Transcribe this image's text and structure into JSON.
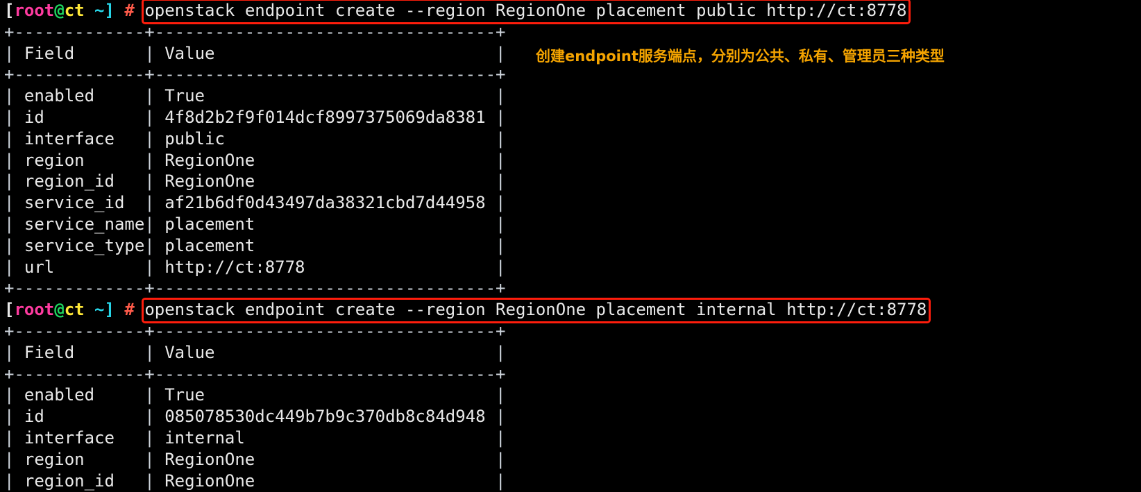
{
  "terminal": {
    "prompt": {
      "open_bracket": "[",
      "user": "root",
      "at": "@",
      "host": "ct",
      "path_close": " ~]",
      "hash": " # "
    },
    "colors": {
      "background": "#000000",
      "foreground": "#d8d8d8",
      "user": "#ff3ba0",
      "at": "#1ed760",
      "host": "#ffe838",
      "path": "#27d5e8",
      "hash": "#ff5b4a",
      "highlight_box": "#fe1d0c",
      "annotation": "#f5a400"
    },
    "commands": [
      "openstack endpoint create --region RegionOne placement public http://ct:8778",
      "openstack endpoint create --region RegionOne placement internal http://ct:8778"
    ],
    "annotation": "创建endpoint服务端点，分别为公共、私有、管理员三种类型",
    "block1": {
      "rule": "+-------------+----------------------------------+",
      "header_field": "Field",
      "header_value": "Value",
      "rows": [
        {
          "field": "enabled",
          "value": "True"
        },
        {
          "field": "id",
          "value": "4f8d2b2f9f014dcf8997375069da8381"
        },
        {
          "field": "interface",
          "value": "public"
        },
        {
          "field": "region",
          "value": "RegionOne"
        },
        {
          "field": "region_id",
          "value": "RegionOne"
        },
        {
          "field": "service_id",
          "value": "af21b6df0d43497da38321cbd7d44958"
        },
        {
          "field": "service_name",
          "value": "placement"
        },
        {
          "field": "service_type",
          "value": "placement"
        },
        {
          "field": "url",
          "value": "http://ct:8778"
        }
      ]
    },
    "block2": {
      "rule": "+-------------+----------------------------------+",
      "header_field": "Field",
      "header_value": "Value",
      "rows": [
        {
          "field": "enabled",
          "value": "True"
        },
        {
          "field": "id",
          "value": "085078530dc449b7b9c370db8c84d948"
        },
        {
          "field": "interface",
          "value": "internal"
        },
        {
          "field": "region",
          "value": "RegionOne"
        },
        {
          "field": "region_id",
          "value": "RegionOne"
        }
      ]
    }
  }
}
